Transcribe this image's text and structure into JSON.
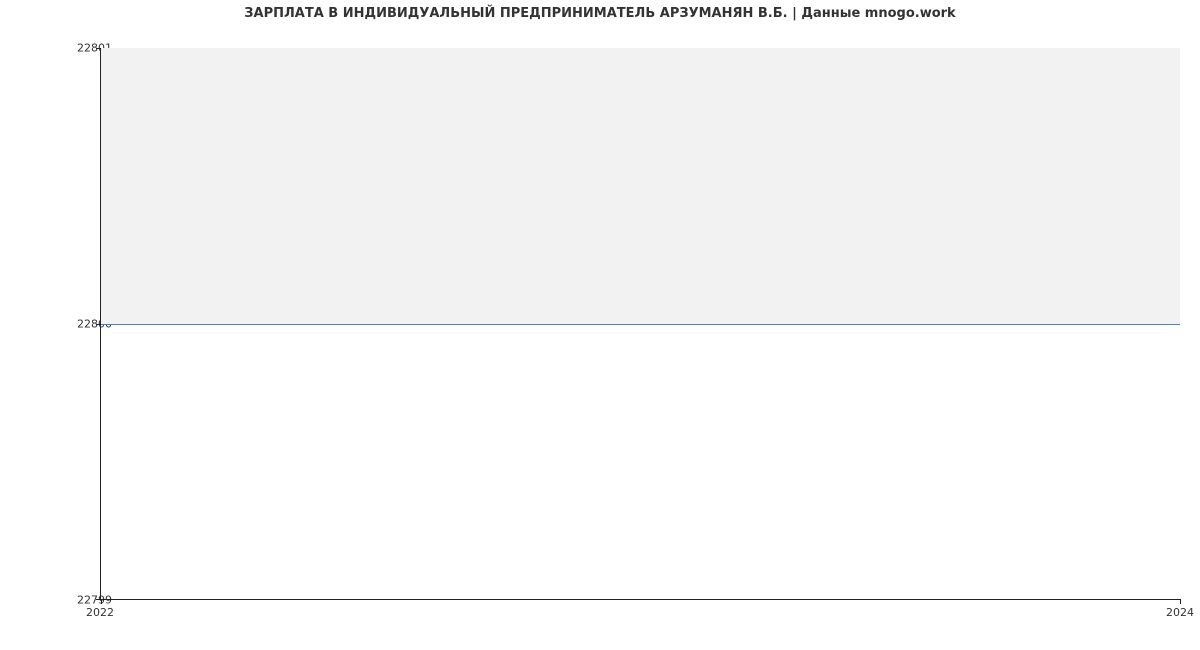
{
  "chart_data": {
    "type": "line",
    "title": "ЗАРПЛАТА В ИНДИВИДУАЛЬНЫЙ ПРЕДПРИНИМАТЕЛЬ АРЗУМАНЯН В.Б. | Данные mnogo.work",
    "x": [
      2022,
      2024
    ],
    "values": [
      22800,
      22800
    ],
    "xlabel": "",
    "ylabel": "",
    "xlim": [
      2022,
      2024
    ],
    "ylim": [
      22799,
      22801
    ],
    "xticks": [
      2022,
      2024
    ],
    "yticks": [
      22799,
      22800,
      22801
    ],
    "line_color": "#4a7fd1",
    "fill_above_color": "#f2f2f2"
  }
}
